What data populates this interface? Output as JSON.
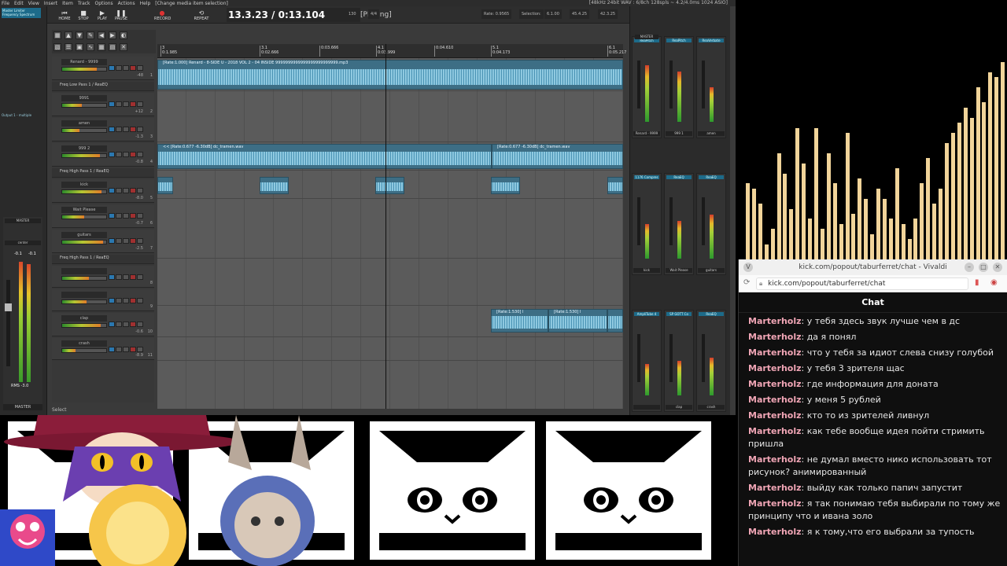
{
  "daw": {
    "menu": [
      "File",
      "Edit",
      "View",
      "Insert",
      "Item",
      "Track",
      "Options",
      "Actions",
      "Help",
      "[Change media item selection]"
    ],
    "status": "[48kHz 24bit WAV : 6/8ch 128spls ~ 4.2/4.0ms 1024 ASIO]",
    "transport": {
      "buttons": [
        "HOME",
        "STOP",
        "PLAY",
        "PAUSE",
        "RECORD",
        "REPEAT"
      ],
      "time": "13.3.23 / 0:13.104",
      "state": "[Playing]",
      "bpm": "130",
      "sig": "4/4",
      "rate": "Rate: 0.9565",
      "selection_label": "Selection:",
      "selection_start": "6.1.00",
      "selection_end": "45.4.25",
      "selection_len": "42.3.25"
    },
    "left_panel": {
      "fx1": "Master Limiter",
      "fx2": "Frequency Spectrum",
      "label": "Output 1 - multiple",
      "master_label": "MASTER",
      "pan": "center",
      "rms": "RMS -3.0",
      "bottom": "MASTER",
      "meter_top_l": "-0.1",
      "meter_top_r": "-0.1",
      "meter_level_l": 0.9,
      "meter_level_r": 0.88
    },
    "select_hint": "Select",
    "ruler": [
      {
        "label": "3",
        "sub": "0:1.985"
      },
      {
        "label": "3.1",
        "sub": "0:02.666"
      },
      {
        "label": "",
        "sub": "0:03.666"
      },
      {
        "label": "4.1",
        "sub": "0:03.999"
      },
      {
        "label": "",
        "sub": "0:04.610"
      },
      {
        "label": "5.1",
        "sub": "0:04.173"
      },
      {
        "label": "6.1",
        "sub": "0:05.217"
      }
    ],
    "tracks": [
      {
        "name": "Renard - 9999",
        "num": "1",
        "vol": "-48",
        "pan": "0",
        "folder": false,
        "fill": 0.78
      },
      {
        "name": "Freq Low Pass 1 / ReaEQ",
        "num": "2",
        "folder": true
      },
      {
        "name": "9991",
        "num": "2",
        "vol": "+12",
        "folder": false,
        "fill": 0.45
      },
      {
        "name": "amen",
        "num": "3",
        "vol": "-1.3",
        "folder": false,
        "fill": 0.4
      },
      {
        "name": "999 2",
        "num": "4",
        "vol": "-0.8",
        "folder": false,
        "fill": 0.85
      },
      {
        "name": "Freq High Pass 1 / ReaEQ",
        "num": "",
        "folder": true
      },
      {
        "name": "kick",
        "num": "5",
        "vol": "-8.0",
        "folder": false,
        "fill": 0.9
      },
      {
        "name": "Wait Please",
        "num": "6",
        "vol": "-0.7",
        "folder": false,
        "fill": 0.5
      },
      {
        "name": "guitars",
        "num": "7",
        "vol": "-2.5",
        "folder": false,
        "fill": 0.92
      },
      {
        "name": "Freq High Pass 1 / ReaEQ",
        "num": "",
        "folder": true
      },
      {
        "name": "",
        "num": "8",
        "vol": "",
        "folder": false,
        "fill": 0.6
      },
      {
        "name": "",
        "num": "9",
        "vol": "",
        "folder": false,
        "fill": 0.55
      },
      {
        "name": "clap",
        "num": "10",
        "vol": "-0.6",
        "folder": false,
        "fill": 0.88
      },
      {
        "name": "crash",
        "num": "11",
        "vol": "-8.9",
        "folder": false,
        "fill": 0.3
      }
    ],
    "clips": {
      "top": "[Rate:1.000] Renard - 8-SIDE U - 2018 VOL 2 - 04 INSIDE 9999999999999999999999999.mp3",
      "dc1": "<< [Rate:0.677 -6.30dB] dc_tramen.wav",
      "dc2": "[Rate:0.677 -6.30dB] dc_tramen.wav",
      "clap1": "[Rate:1.530] I",
      "clap2": "[Rate:1.530] I"
    },
    "mixer": {
      "fx_top": [
        "ReaPitch",
        "ReaEQ",
        "ReaPitch",
        "SP GOTT Co",
        "ReaVerbate",
        "ReaEQ"
      ],
      "row1_names": [
        "Renard - 9999",
        "999 1",
        "amen"
      ],
      "row1_fx": [
        "1176 Compres",
        "ReaEQ",
        "ReaEQ"
      ],
      "row2_names": [
        "kick",
        "Wait Please",
        "guitars"
      ],
      "row2_fx": [
        "AmpliTube 4",
        "SP GOTT Co",
        "ReaEQ"
      ],
      "row3_names": [
        "",
        "clap",
        "crash"
      ],
      "master": "MASTER",
      "nums": [
        "1",
        "2",
        "3",
        "4",
        "5",
        "6",
        "7",
        "8",
        "9",
        "10",
        "11"
      ]
    }
  },
  "visualizer": {
    "bars": [
      0.3,
      0.28,
      0.22,
      0.06,
      0.12,
      0.42,
      0.34,
      0.2,
      0.52,
      0.38,
      0.16,
      0.52,
      0.12,
      0.42,
      0.3,
      0.14,
      0.5,
      0.18,
      0.32,
      0.24,
      0.1,
      0.28,
      0.24,
      0.16,
      0.36,
      0.14,
      0.08,
      0.16,
      0.3,
      0.4,
      0.22,
      0.28,
      0.46,
      0.5,
      0.54,
      0.6,
      0.56,
      0.68,
      0.62,
      0.74,
      0.72,
      0.78,
      0.58
    ]
  },
  "chat": {
    "window_title": "kick.com/popout/taburferret/chat - Vivaldi",
    "url": "kick.com/popout/taburferret/chat",
    "header": "Chat",
    "username_color": "#f0a5b5",
    "messages": [
      {
        "user": "Marterholz",
        "text": "у тебя здесь звук лучше чем в дс"
      },
      {
        "user": "Marterholz",
        "text": "да я понял"
      },
      {
        "user": "Marterholz",
        "text": "что у тебя за идиот слева снизу голубой"
      },
      {
        "user": "Marterholz",
        "text": "у тебя 3 зрителя щас"
      },
      {
        "user": "Marterholz",
        "text": "где информация для доната"
      },
      {
        "user": "Marterholz",
        "text": "у меня 5 рублей"
      },
      {
        "user": "Marterholz",
        "text": "кто то из зрителей ливнул"
      },
      {
        "user": "Marterholz",
        "text": "как тебе вообще идея пойти стримить пришла"
      },
      {
        "user": "Marterholz",
        "text": "не думал вместо нико использовать тот рисунок? анимированный"
      },
      {
        "user": "Marterholz",
        "text": "выйду как только папич запустит"
      },
      {
        "user": "Marterholz",
        "text": "я так понимаю тебя выбирали по тому же принципу что и ивана золо"
      },
      {
        "user": "Marterholz",
        "text": "я к тому,что его выбрали за тупость"
      }
    ]
  }
}
